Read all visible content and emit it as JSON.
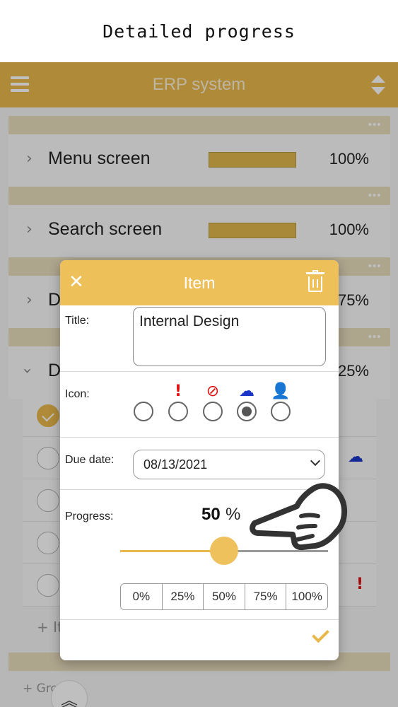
{
  "caption": "Detailed progress",
  "app": {
    "title": "ERP system",
    "groups": [
      {
        "name": "Menu screen",
        "progress": 100,
        "progress_text": "100%"
      },
      {
        "name": "Search screen",
        "progress": 100,
        "progress_text": "100%"
      },
      {
        "name": "D",
        "progress": 75,
        "progress_text": "75%"
      },
      {
        "name": "D",
        "progress": 25,
        "progress_text": "25%"
      }
    ],
    "add_item_label": "+ It",
    "add_group_label": "+ Gro"
  },
  "dialog": {
    "title": "Item",
    "title_label": "Title:",
    "title_value": "Internal Design",
    "icon_label": "Icon:",
    "icons": [
      {
        "name": "none",
        "selected": false
      },
      {
        "name": "exclamation-icon",
        "color": "#e01010",
        "selected": false
      },
      {
        "name": "prohibited-icon",
        "color": "#e01010",
        "selected": false
      },
      {
        "name": "rain-cloud-icon",
        "color": "#1a35c8",
        "selected": true
      },
      {
        "name": "user-check-icon",
        "color": "#111111",
        "selected": false
      }
    ],
    "due_date_label": "Due date:",
    "due_date_value": "08/13/2021",
    "progress_label": "Progress:",
    "progress_value": "50",
    "progress_unit": "%",
    "progress_fraction": 0.5,
    "presets": [
      "0%",
      "25%",
      "50%",
      "75%",
      "100%"
    ]
  },
  "colors": {
    "accent": "#e8b84d",
    "group_header": "#e9dcbc",
    "icon_red": "#e01010",
    "icon_blue": "#1a35c8"
  }
}
